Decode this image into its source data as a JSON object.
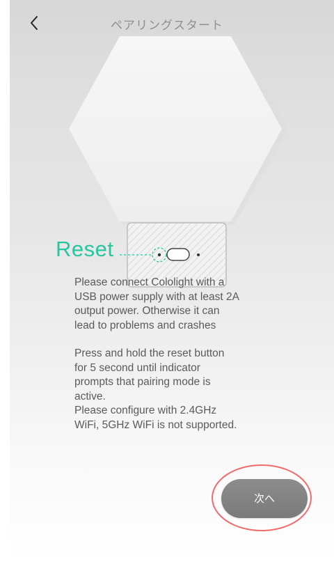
{
  "header": {
    "title": "ペアリングスタート",
    "back_icon": "chevron-left-icon"
  },
  "device_illustration": {
    "reset_label": "Reset",
    "accent_color": "#25c79f"
  },
  "instructions": {
    "paragraph_1": "Please connect Cololight with a\nUSB power supply with at least 2A\noutput power. Otherwise it can\nlead to problems and crashes",
    "paragraph_2": "Press and hold the reset button\nfor 5 second until indicator\nprompts that pairing mode is\nactive.\nPlease configure with 2.4GHz\nWiFi, 5GHz WiFi is not supported."
  },
  "footer": {
    "next_label": "次へ",
    "highlight_color": "#f26a6a"
  }
}
